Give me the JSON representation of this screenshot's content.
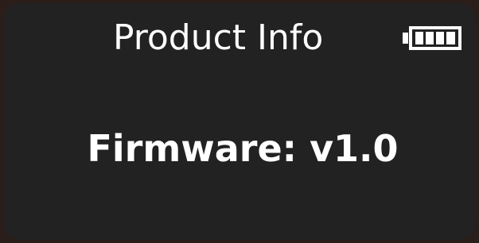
{
  "header": {
    "title": "Product Info",
    "battery_icon": "battery-full-icon",
    "battery_level": 1.0
  },
  "main": {
    "firmware_label": "Firmware:",
    "firmware_version": "v1.0"
  },
  "colors": {
    "screen_background": "#222222",
    "bezel": "#2a1d1a",
    "text": "#ffffff"
  }
}
